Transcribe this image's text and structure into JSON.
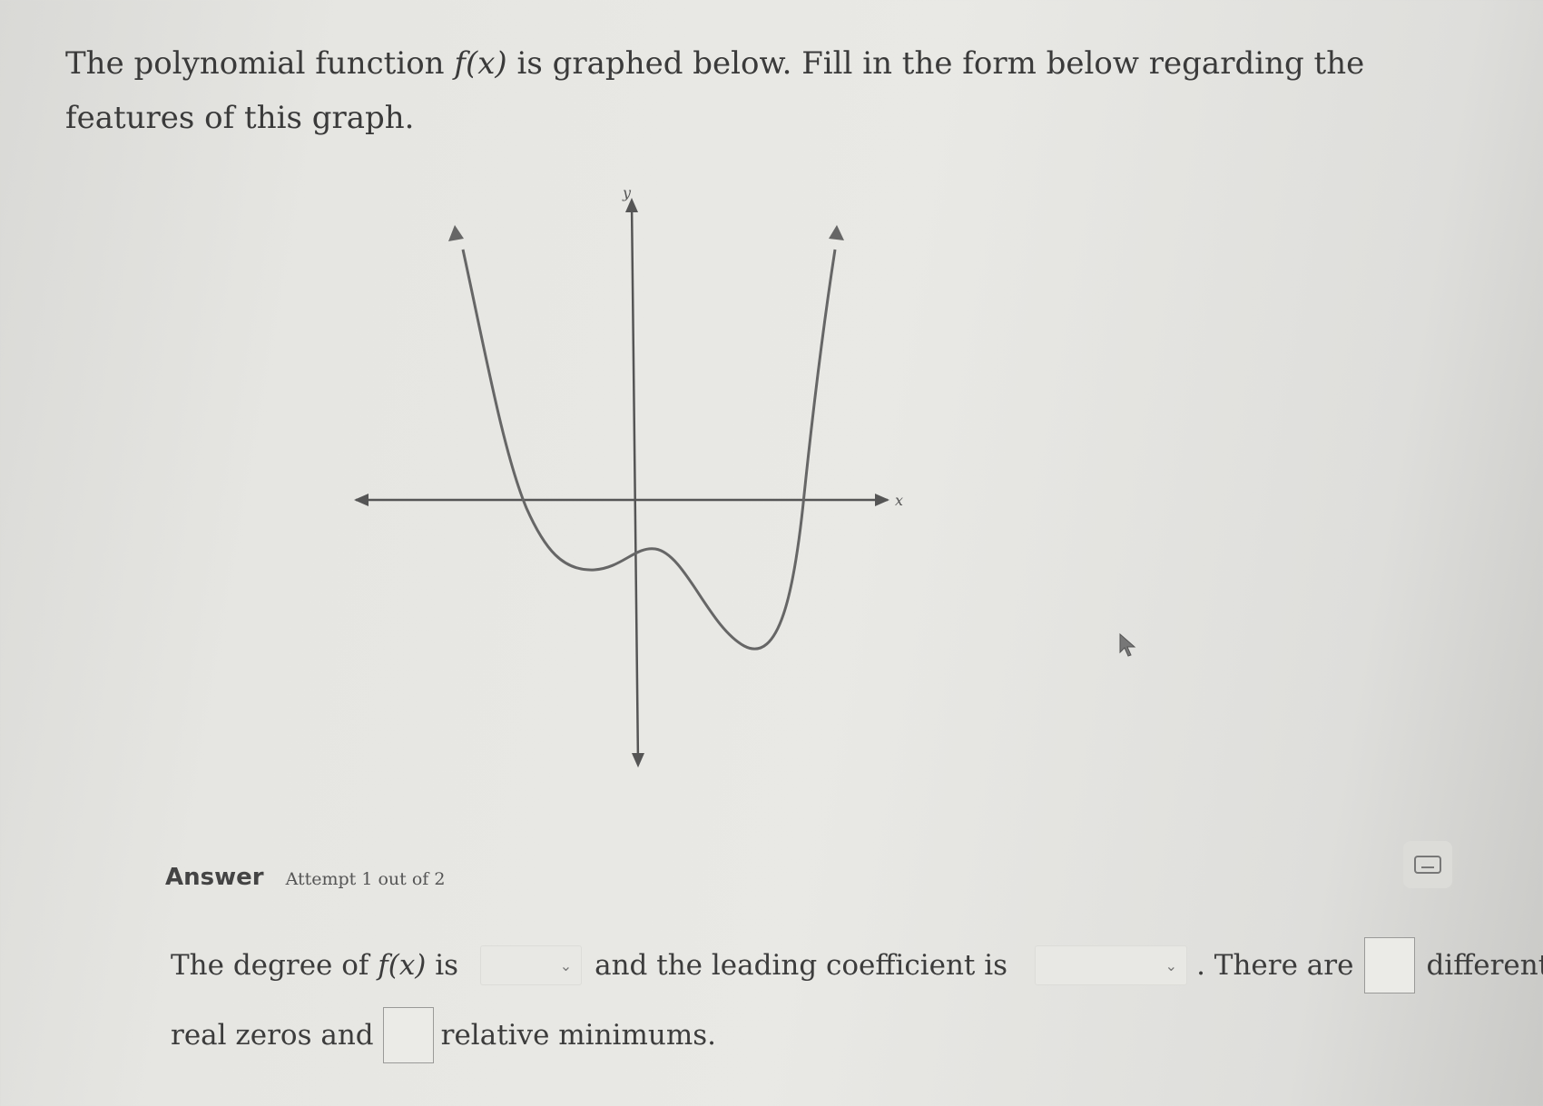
{
  "question": {
    "part1": "The polynomial function",
    "func": "f(x)",
    "part2": "is graphed below. Fill in the form below regarding the features of this graph."
  },
  "graph": {
    "x_label": "x",
    "y_label": "y",
    "curve_color": "#666666",
    "axis_color": "#555555"
  },
  "answer": {
    "label": "Answer",
    "attempt": "Attempt 1 out of 2",
    "keypad_icon": "keyboard-icon"
  },
  "form": {
    "s1": "The degree of",
    "func": "f(x)",
    "s2": "is",
    "degree_value": "",
    "s3": "and the leading coefficient is",
    "leading_value": "",
    "s4": ". There are",
    "zeros_value": "",
    "s5": "different",
    "s6": "real zeros and",
    "minimums_value": "",
    "s7": "relative minimums."
  }
}
